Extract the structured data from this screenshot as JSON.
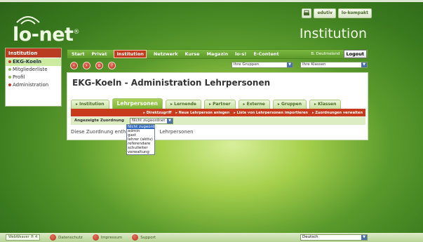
{
  "logo": {
    "text": "lo-net",
    "suffix": "®"
  },
  "header": {
    "title": "Institution"
  },
  "toplinks": {
    "print_icon": "printer-icon",
    "edutiv": "edutiv",
    "lokompakt": "lo-kompakt"
  },
  "sidebar": {
    "header": "Institution",
    "items": [
      {
        "label": "EKG-Koeln"
      },
      {
        "label": "Mitgliederliste"
      },
      {
        "label": "Profil"
      },
      {
        "label": "Administration"
      }
    ]
  },
  "nav": {
    "items": [
      "Start",
      "Privat",
      "Institution",
      "Netzwerk",
      "Kurse",
      "Magazin",
      "lo-s!",
      "E-Content"
    ],
    "user": "B. Deutmeland",
    "logout": "Logout"
  },
  "subnav": {
    "icons": [
      "back-icon",
      "forward-icon",
      "home-icon",
      "help-icon"
    ],
    "groups_select": "Ihre Gruppen",
    "classes_select": "Ihre Klassen"
  },
  "main": {
    "title": "EKG-Koeln - Administration Lehrpersonen",
    "tabs": [
      "Institution",
      "Lehrpersonen",
      "Lernende",
      "Partner",
      "Externe",
      "Gruppen",
      "Klassen"
    ],
    "actions": [
      "Direktzugriff",
      "Neue Lehrperson anlegen",
      "Liste von Lehrpersonen importieren",
      "Zuordnungen verwalten"
    ],
    "filter_label": "Angezeigte Zuordnung",
    "filter_value": "Nicht zugeordnet",
    "info_prefix": "Diese Zuordnung enth",
    "info_suffix": "Lehrpersonen"
  },
  "dropdown": {
    "options": [
      "Nicht zugeordnet",
      "admin",
      "gast",
      "lehrer (aktiv)",
      "referendare",
      "schulleiter",
      "verwaltung"
    ]
  },
  "footer": {
    "badge": "WebWeaver ® 4",
    "links": [
      "Datenschutz",
      "Impressum",
      "Support"
    ],
    "language": "Deutsch"
  }
}
